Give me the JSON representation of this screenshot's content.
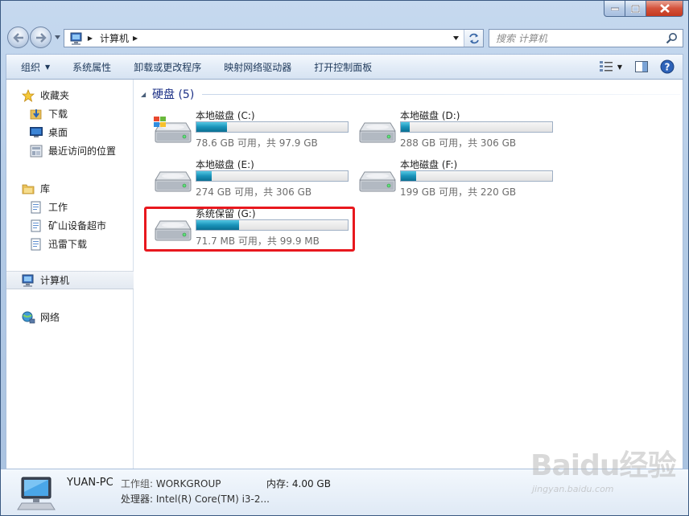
{
  "breadcrumb": {
    "location": "计算机"
  },
  "search": {
    "placeholder": "搜索 计算机"
  },
  "toolbar": {
    "organize": "组织",
    "system_properties": "系统属性",
    "uninstall": "卸载或更改程序",
    "map_drive": "映射网络驱动器",
    "control_panel": "打开控制面板"
  },
  "sidebar": {
    "favorites": {
      "label": "收藏夹",
      "items": [
        "下载",
        "桌面",
        "最近访问的位置"
      ]
    },
    "libraries": {
      "label": "库",
      "items": [
        "工作",
        "矿山设备超市",
        "迅雷下载"
      ]
    },
    "computer": "计算机",
    "network": "网络"
  },
  "group": {
    "title": "硬盘 (5)"
  },
  "drives": [
    {
      "name": "本地磁盘 (C:)",
      "size": "78.6 GB 可用，共 97.9 GB",
      "used_fraction": 0.2,
      "system": true
    },
    {
      "name": "本地磁盘 (D:)",
      "size": "288 GB 可用，共 306 GB",
      "used_fraction": 0.06,
      "system": false
    },
    {
      "name": "本地磁盘 (E:)",
      "size": "274 GB 可用，共 306 GB",
      "used_fraction": 0.1,
      "system": false
    },
    {
      "name": "本地磁盘 (F:)",
      "size": "199 GB 可用，共 220 GB",
      "used_fraction": 0.1,
      "system": false
    },
    {
      "name": "系统保留 (G:)",
      "size": "71.7 MB 可用，共 99.9 MB",
      "used_fraction": 0.28,
      "system": false
    }
  ],
  "details": {
    "pc_name": "YUAN-PC",
    "workgroup_label": "工作组:",
    "workgroup": "WORKGROUP",
    "memory_label": "内存:",
    "memory": "4.00 GB",
    "processor_label": "处理器:",
    "processor": "Intel(R) Core(TM) i3-2..."
  },
  "watermark": {
    "brand": "Baidu经验",
    "url": "jingyan.baidu.com"
  },
  "colors": {
    "highlight": "#e8181e",
    "bar_fill": "#1993b9",
    "group_title": "#1e3287"
  }
}
